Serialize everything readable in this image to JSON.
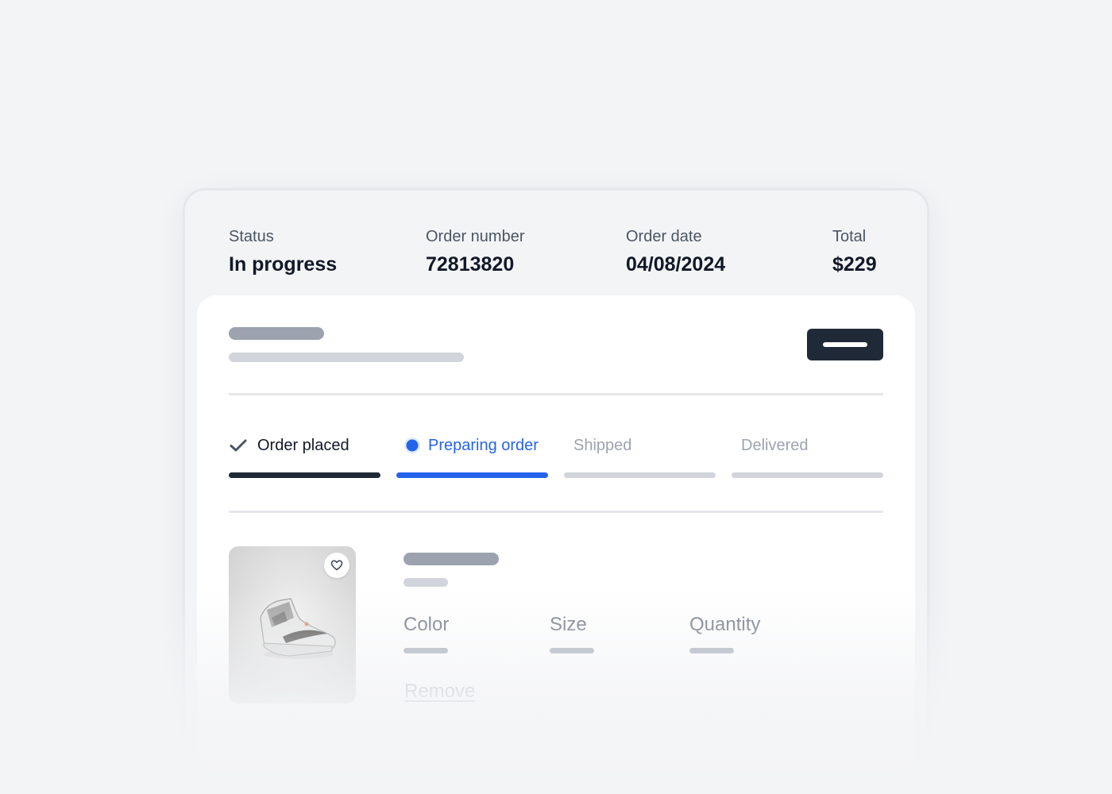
{
  "order": {
    "status": {
      "label": "Status",
      "value": "In progress"
    },
    "number": {
      "label": "Order number",
      "value": "72813820"
    },
    "date": {
      "label": "Order date",
      "value": "04/08/2024"
    },
    "total": {
      "label": "Total",
      "value": "$229"
    }
  },
  "progress": {
    "steps": [
      {
        "label": "Order placed",
        "state": "complete",
        "icon": "check-icon"
      },
      {
        "label": "Preparing order",
        "state": "current",
        "icon": "current-step-dot-icon"
      },
      {
        "label": "Shipped",
        "state": "pending"
      },
      {
        "label": "Delivered",
        "state": "pending"
      }
    ]
  },
  "item": {
    "image": "sneaker-product-image",
    "favorite_icon": "heart-icon",
    "attributes": {
      "color_label": "Color",
      "size_label": "Size",
      "quantity_label": "Quantity"
    },
    "remove_label": "Remove"
  },
  "colors": {
    "accent": "#2563eb",
    "dark": "#1f2937",
    "muted": "#9ca3af",
    "track": "#d1d5db",
    "background": "#f3f4f6"
  }
}
